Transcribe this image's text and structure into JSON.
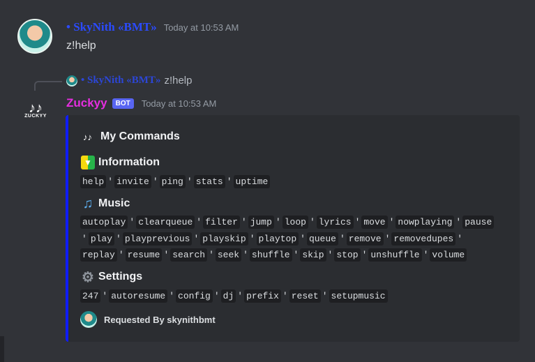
{
  "message1": {
    "author": "• SkyNith «BMT»",
    "timestamp": "Today at 10:53 AM",
    "content": "z!help"
  },
  "reply": {
    "author": "• SkyNith «BMT»",
    "content": "z!help"
  },
  "bot": {
    "logo_text": "ZUCKYY",
    "name": "Zuckyy",
    "badge": "BOT",
    "timestamp": "Today at 10:53 AM"
  },
  "embed": {
    "title": "My Commands",
    "accent_color": "#0f1cff",
    "sections": [
      {
        "title": "Information",
        "icon": "beginner-icon",
        "rows": [
          [
            "help",
            "invite",
            "ping",
            "stats",
            "uptime"
          ]
        ]
      },
      {
        "title": "Music",
        "icon": "notes-icon",
        "rows": [
          [
            "autoplay",
            "clearqueue",
            "filter",
            "jump",
            "loop",
            "lyrics",
            "move",
            "nowplaying",
            "pause"
          ],
          [
            "play",
            "playprevious",
            "playskip",
            "playtop",
            "queue",
            "remove",
            "removedupes"
          ],
          [
            "replay",
            "resume",
            "search",
            "seek",
            "shuffle",
            "skip",
            "stop",
            "unshuffle",
            "volume"
          ]
        ]
      },
      {
        "title": "Settings",
        "icon": "gear-icon",
        "rows": [
          [
            "247",
            "autoresume",
            "config",
            "dj",
            "prefix",
            "reset",
            "setupmusic"
          ]
        ]
      }
    ],
    "footer": "Requested By skynithbmt"
  }
}
